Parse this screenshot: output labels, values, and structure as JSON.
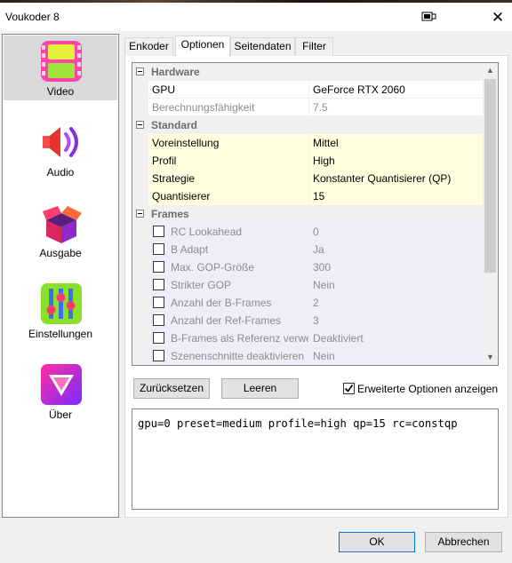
{
  "window": {
    "title": "Voukoder 8"
  },
  "sidebar": {
    "items": [
      {
        "label": "Video",
        "icon": "video-film-icon",
        "active": true
      },
      {
        "label": "Audio",
        "icon": "speaker-icon"
      },
      {
        "label": "Ausgabe",
        "icon": "open-box-icon"
      },
      {
        "label": "Einstellungen",
        "icon": "sliders-icon"
      },
      {
        "label": "Über",
        "icon": "about-logo-icon"
      }
    ]
  },
  "tabs": [
    {
      "label": "Enkoder"
    },
    {
      "label": "Optionen",
      "active": true
    },
    {
      "label": "Seitendaten"
    },
    {
      "label": "Filter"
    }
  ],
  "grid": {
    "hardware": {
      "label": "Hardware",
      "rows": [
        {
          "name": "GPU",
          "value": "GeForce RTX 2060"
        },
        {
          "name": "Berechnungsfähigkeit",
          "value": "7.5"
        }
      ]
    },
    "standard": {
      "label": "Standard",
      "rows": [
        {
          "name": "Voreinstellung",
          "value": "Mittel"
        },
        {
          "name": "Profil",
          "value": "High"
        },
        {
          "name": "Strategie",
          "value": "Konstanter Quantisierer (QP)"
        },
        {
          "name": "Quantisierer",
          "value": "15"
        }
      ]
    },
    "frames": {
      "label": "Frames",
      "rows": [
        {
          "name": "RC Lookahead",
          "value": "0"
        },
        {
          "name": "B Adapt",
          "value": "Ja"
        },
        {
          "name": "Max. GOP-Größe",
          "value": "300"
        },
        {
          "name": "Strikter GOP",
          "value": "Nein"
        },
        {
          "name": "Anzahl der B-Frames",
          "value": "2"
        },
        {
          "name": "Anzahl der Ref-Frames",
          "value": "3"
        },
        {
          "name": "B-Frames als Referenz verwenden",
          "value": "Deaktiviert"
        },
        {
          "name": "Szenenschnitte deaktivieren",
          "value": "Nein"
        }
      ]
    }
  },
  "buttons": {
    "reset": "Zurücksetzen",
    "clear": "Leeren",
    "ok": "OK",
    "cancel": "Abbrechen"
  },
  "advanced": {
    "label": "Erweiterte Optionen anzeigen",
    "checked": true
  },
  "command": "gpu=0 preset=medium profile=high qp=15 rc=constqp"
}
